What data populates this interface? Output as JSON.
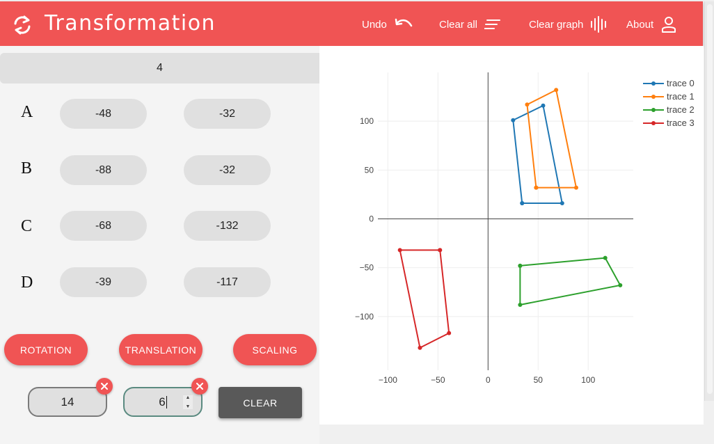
{
  "header": {
    "title": "Transformation",
    "nav": [
      {
        "label": "Undo",
        "icon": "undo-icon"
      },
      {
        "label": "Clear all",
        "icon": "clear-all-icon"
      },
      {
        "label": "Clear graph",
        "icon": "waveform-icon"
      },
      {
        "label": "About",
        "icon": "user-icon"
      }
    ]
  },
  "colors": {
    "accent": "#f05454",
    "dark_button": "#595959",
    "field_bg": "#e0e0e0",
    "trace0": "#1f77b4",
    "trace1": "#ff7f0e",
    "trace2": "#2ca02c",
    "trace3": "#d62728"
  },
  "count": "4",
  "points": [
    {
      "label": "A",
      "x": "-48",
      "y": "-32"
    },
    {
      "label": "B",
      "x": "-88",
      "y": "-32"
    },
    {
      "label": "C",
      "x": "-68",
      "y": "-132"
    },
    {
      "label": "D",
      "x": "-39",
      "y": "-117"
    }
  ],
  "actions": {
    "rotation": "ROTATION",
    "translation": "TRANSLATION",
    "scaling": "SCALING"
  },
  "params": {
    "first_value": "14",
    "second_value": "6",
    "clear_label": "CLEAR"
  },
  "chart_data": {
    "type": "scatter",
    "mode": "lines+markers",
    "title": "",
    "xlabel": "",
    "ylabel": "",
    "xlim": [
      -110,
      145
    ],
    "ylim": [
      -155,
      150
    ],
    "xticks": [
      -100,
      -50,
      0,
      50,
      100
    ],
    "xtick_labels": [
      "−100",
      "−50",
      "0",
      "50",
      "100"
    ],
    "yticks": [
      -100,
      -50,
      0,
      50,
      100
    ],
    "ytick_labels": [
      "−100",
      "−50",
      "0",
      "50",
      "100"
    ],
    "grid": true,
    "legend": "top-right",
    "series": [
      {
        "name": "trace 0",
        "color": "#1f77b4",
        "x": [
          34,
          74,
          55,
          25,
          34
        ],
        "y": [
          16,
          16,
          116,
          101,
          16
        ]
      },
      {
        "name": "trace 1",
        "color": "#ff7f0e",
        "x": [
          48,
          88,
          68,
          39,
          48
        ],
        "y": [
          32,
          32,
          132,
          117,
          32
        ]
      },
      {
        "name": "trace 2",
        "color": "#2ca02c",
        "x": [
          32,
          117,
          132,
          32,
          32
        ],
        "y": [
          -48,
          -40,
          -68,
          -88,
          -48
        ]
      },
      {
        "name": "trace 3",
        "color": "#d62728",
        "x": [
          -48,
          -88,
          -68,
          -39,
          -48
        ],
        "y": [
          -32,
          -32,
          -132,
          -117,
          -32
        ]
      }
    ]
  }
}
